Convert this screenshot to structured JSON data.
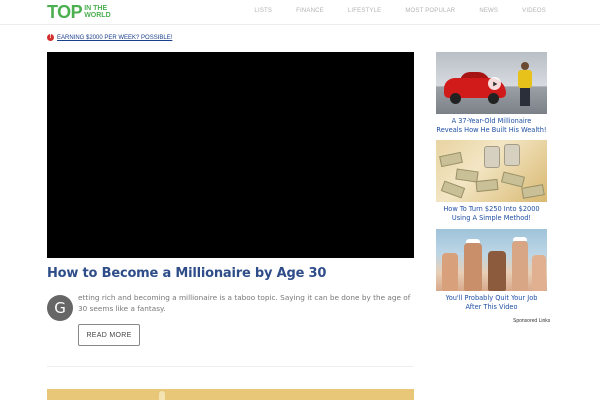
{
  "logo": {
    "main": "TOP",
    "line1": "IN THE",
    "line2": "WORLD"
  },
  "nav": [
    "LISTS",
    "FINANCE",
    "LIFESTYLE",
    "MOST POPULAR",
    "NEWS",
    "VIDEOS"
  ],
  "notice": {
    "icon": "!",
    "text": "EARNING $2000 PER WEEK? POSSIBLE!"
  },
  "article": {
    "title": "How to Become a Millionaire by Age 30",
    "dropcap": "G",
    "excerpt": "etting rich and becoming a millionaire is a taboo topic. Saying it can be done by the age of 30 seems like a fantasy.",
    "read_more": "READ MORE"
  },
  "ads": [
    {
      "caption_line1": "A 37-Year-Old Millionaire",
      "caption_line2": "Reveals How He Built His Wealth!",
      "image": "red-sports-car-photo"
    },
    {
      "caption_line1": "How To Turn $250 Into $2000",
      "caption_line2": "Using A Simple Method!",
      "image": "cash-stacks-photo"
    },
    {
      "caption_line1": "You'll Probably Quit Your Job",
      "caption_line2": "After This Video",
      "image": "yacht-party-photo"
    }
  ],
  "sponsored": "Sponsored Links",
  "colors": {
    "logo_green": "#4caf50",
    "title_blue": "#2e4d89",
    "link_blue": "#1f4fa3",
    "notice_red": "#d32f2f"
  }
}
